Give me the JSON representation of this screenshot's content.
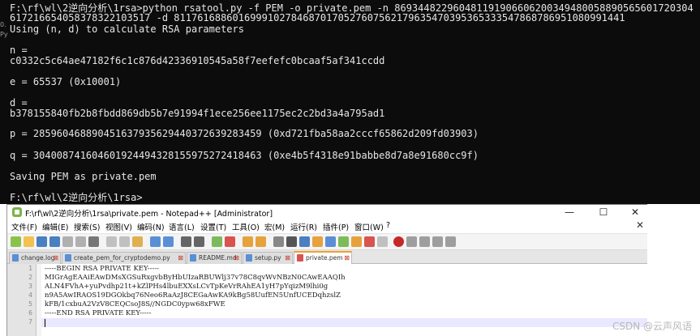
{
  "console": {
    "lines": [
      "F:\\rf\\wl\\2逆向分析\\1rsa>python rsatool.py -f PEM -o private.pem -n 869344822960481191906606200349480058890565601720304",
      "6172166540583783221035​17 -d 8117616886016999102784687017052760756217963547039536533354786878695108099144​1",
      "Using (n, d) to calculate RSA parameters",
      "",
      "n =",
      "c0332c5c64ae47182f6c1c876d42336910545a58f7eefefc0bcaaf5af341ccdd",
      "",
      "e = 65537 (0x10001)",
      "",
      "d =",
      "b378155840fb2b8fbdd869db5b7e91994f1ece256ee1175ec2c2bd3a4a795ad1",
      "",
      "p = 285960468890451637935629440372639283459 (0xd721fba58aa2cccf65862d209fd03903)",
      "",
      "q = 304008741604601924494328155975272418463 (0xe4b5f4318e91babbe8d7a8e91680cc9f)",
      "",
      "Saving PEM as private.pem",
      "",
      "F:\\rf\\wl\\2逆向分析\\1rsa>"
    ],
    "left_fragments": [
      "0.",
      "Py"
    ]
  },
  "notepad": {
    "title": "F:\\rf\\wl\\2逆向分析\\1rsa\\private.pem - Notepad++ [Administrator]",
    "window_controls": {
      "minimize": "—",
      "maximize": "☐",
      "close": "✕"
    },
    "menu": [
      "文件(F)",
      "编辑(E)",
      "搜索(S)",
      "视图(V)",
      "编码(N)",
      "语言(L)",
      "设置(T)",
      "工具(O)",
      "宏(M)",
      "运行(R)",
      "插件(P)",
      "窗口(W)",
      "?"
    ],
    "menu_close": "✕",
    "tabs": [
      {
        "label": "change.log",
        "active": false
      },
      {
        "label": "create_pem_for_cryptodemo.py",
        "active": false
      },
      {
        "label": "README.md",
        "active": false
      },
      {
        "label": "setup.py",
        "active": false
      },
      {
        "label": "private.pem",
        "active": true
      }
    ],
    "editor": {
      "line_numbers": [
        "1",
        "2",
        "3",
        "4",
        "5",
        "6",
        "7"
      ],
      "lines": [
        "-----BEGIN RSA PRIVATE KEY-----",
        "MIGrAgEAAiEAwDMsXGSuRxgvbByHbUIzaRBUWlj37v78C8qvWvNBzN0CAwEAAQIh",
        "ALN4FVhA+yuPvdhp21t+kZlPHs4lbuEXXsLCvTpKeVrRAhEA1yH7pYqizM9lhi0g",
        "n9A5AwIRAOS19DGOkbq76Neo6RaAzJ8CEGaAwKA9kBg58UufEN5UnfUCEDqhzslZ",
        "kFB/1cxbuA2VzV8CEQCsoJ8S//NGDC0ypw68xFWE",
        "-----END RSA PRIVATE KEY-----",
        ""
      ]
    }
  },
  "watermark": "CSDN @云声风语",
  "colors": {
    "console_bg": "#0c0c0c",
    "console_fg": "#e6e6e6",
    "accent_tab": "#f0a030",
    "current_line": "#e8e8ff"
  }
}
